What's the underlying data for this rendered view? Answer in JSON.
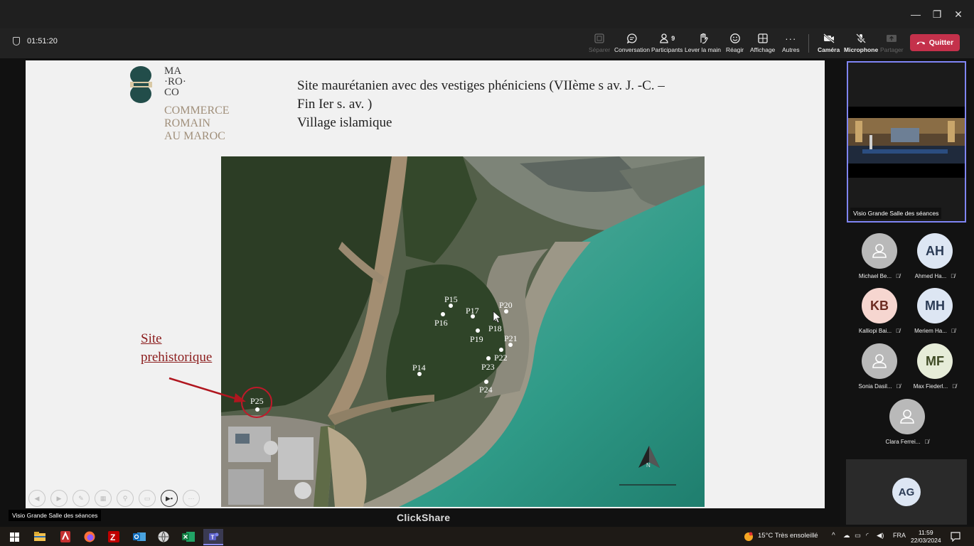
{
  "window": {
    "minimize": "—",
    "restore": "❐",
    "close": "✕"
  },
  "meeting": {
    "timer": "01:51:20",
    "toolbar": [
      {
        "label": "Séparer",
        "icon": "split-icon",
        "disabled": true
      },
      {
        "label": "Conversation",
        "icon": "chat-icon"
      },
      {
        "label": "Participants",
        "icon": "people-icon",
        "badge": "9"
      },
      {
        "label": "Lever la main",
        "icon": "hand-icon"
      },
      {
        "label": "Réagir",
        "icon": "smiley-icon"
      },
      {
        "label": "Affichage",
        "icon": "grid-icon"
      },
      {
        "label": "Autres",
        "icon": "more-icon"
      },
      {
        "label": "Caméra",
        "icon": "camera-off-icon"
      },
      {
        "label": "Microphone",
        "icon": "mic-off-icon"
      },
      {
        "label": "Partager",
        "icon": "share-icon",
        "disabled": true
      }
    ],
    "quit_label": "Quitter"
  },
  "slide": {
    "logo_lines": [
      "MA",
      "·RO·",
      "CO"
    ],
    "logo_subtitle": [
      "COMMERCE",
      "ROMAIN",
      "AU MAROC"
    ],
    "title_lines": [
      "Site maurétanien avec des vestiges phéniciens (VIIème s av. J. -C. –",
      "Fin Ier s. av. )",
      "Village islamique"
    ],
    "prehistoric_label": [
      "Site",
      "prehistorique"
    ],
    "map_points": [
      {
        "label": "P15"
      },
      {
        "label": "P16"
      },
      {
        "label": "P17"
      },
      {
        "label": "P18"
      },
      {
        "label": "P19"
      },
      {
        "label": "P20"
      },
      {
        "label": "P21"
      },
      {
        "label": "P22"
      },
      {
        "label": "P23"
      },
      {
        "label": "P24"
      },
      {
        "label": "P14"
      },
      {
        "label": "P25"
      }
    ],
    "compass_letter": "N"
  },
  "stage": {
    "source_label": "Visio Grande Salle des séances",
    "brand": "ClickShare"
  },
  "panel": {
    "video_label": "Visio Grande Salle des séances",
    "participants": [
      {
        "name": "Michael Be...",
        "initials": "",
        "color": "#b9b9b9"
      },
      {
        "name": "Ahmed Ha...",
        "initials": "AH",
        "color": "#dde6f3"
      },
      {
        "name": "Kalliopi Bai...",
        "initials": "KB",
        "color": "#f6d6d0"
      },
      {
        "name": "Meriem Ha...",
        "initials": "MH",
        "color": "#dde6f3"
      },
      {
        "name": "Sonia Dasil...",
        "initials": "",
        "color": "#b9b9b9"
      },
      {
        "name": "Max Fiederl...",
        "initials": "MF",
        "color": "#e6ecd8"
      },
      {
        "name": "Clara Ferrei...",
        "initials": "",
        "color": "#b9b9b9"
      }
    ],
    "bottom_initials": "AG"
  },
  "taskbar": {
    "weather": "15°C  Très ensoleillé",
    "language": "FRA",
    "time": "11:59",
    "date": "22/03/2024"
  }
}
